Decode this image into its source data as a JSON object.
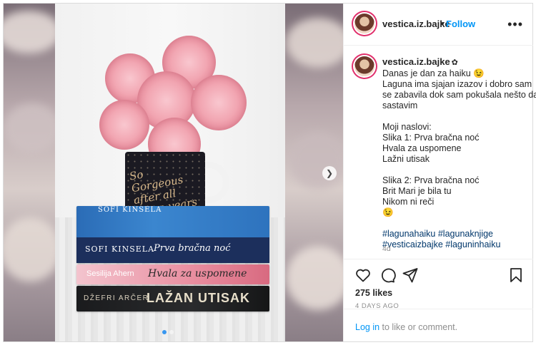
{
  "post": {
    "username": "vestica.iz.bajke",
    "follow_label": "Follow",
    "separator": "•",
    "more_icon": "more-options-icon",
    "caption_lines": [
      "Danas je dan za haiku 😉",
      "Laguna ima sjajan izazov i dobro sam",
      "se zabavila dok sam pokušala nešto da",
      "sastavim",
      "",
      "Moji naslovi:",
      "Slika 1: Prva bračna noć",
      "Hvala za uspomene",
      "Lažni utisak",
      "",
      "Slika 2: Prva bračna noć",
      "Brit Mari je bila tu",
      "Nikom ni reči",
      "😉"
    ],
    "hashtags_line1": [
      "#lagunahaiku",
      "#lagunaknjige"
    ],
    "hashtags_line2": [
      "#vesticaizbajke",
      "#laguninhaiku"
    ],
    "age": "4d",
    "likes": "275 likes",
    "date": "4 DAYS AGO",
    "login_link": "Log in",
    "login_rest": " to like or comment."
  },
  "image": {
    "mug_text": "So Gorgeous after all these years",
    "books": [
      {
        "author": "SOFI KINSELA",
        "title": "Prva bračna noć",
        "spine": "SOFI KINSELA"
      },
      {
        "author": "Sesilija Ahern",
        "title": "Hvala za uspomene"
      },
      {
        "author": "DŽEFRI ARČER",
        "title": "LAŽAN UTISAK"
      }
    ],
    "carousel_dots": 2,
    "active_dot": 0
  },
  "colors": {
    "accent": "#0095f6",
    "text": "#262626",
    "muted": "#8e8e8e",
    "border": "#dbdbdb"
  }
}
